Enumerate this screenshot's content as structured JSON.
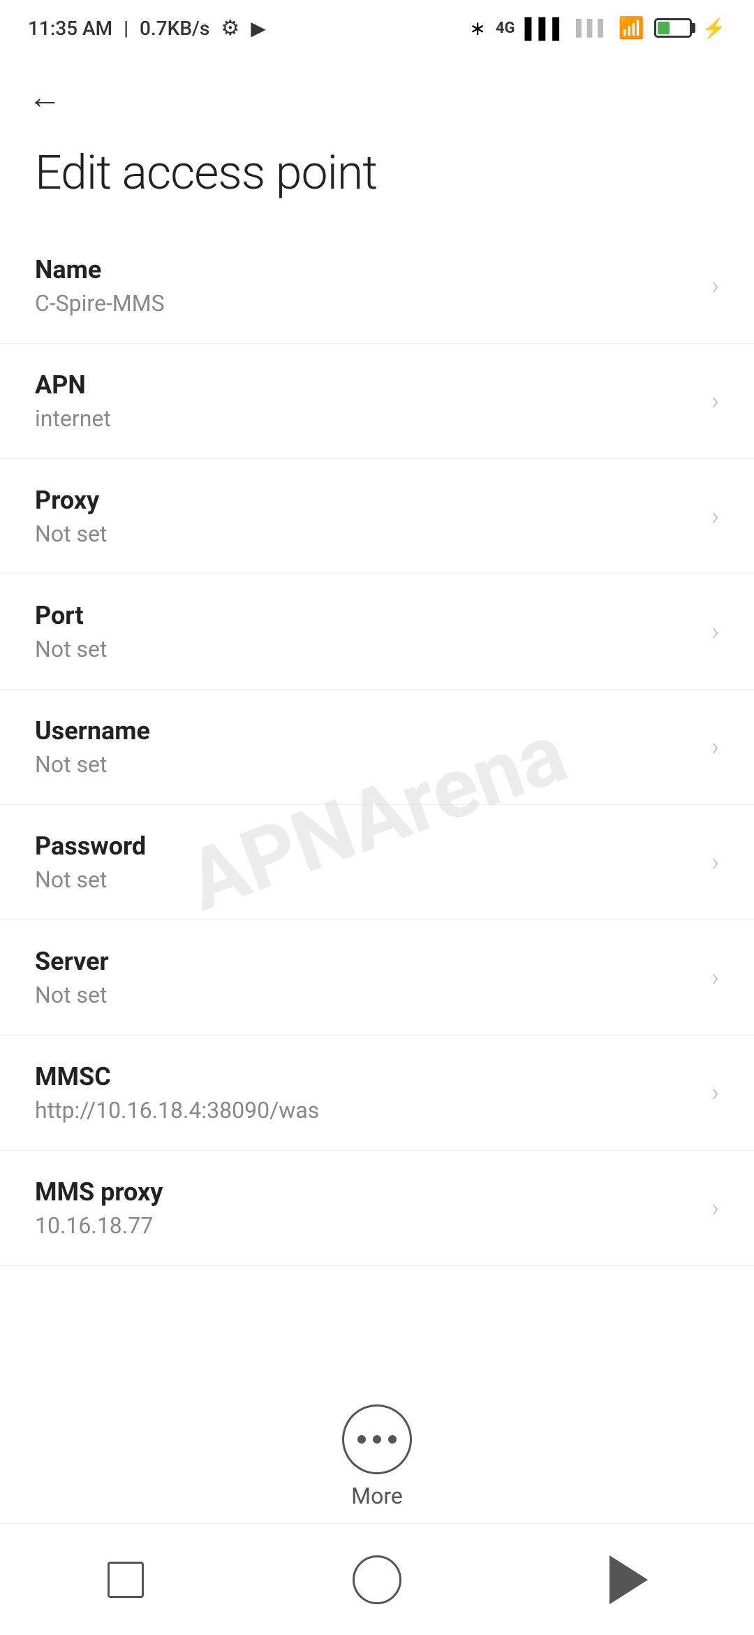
{
  "statusBar": {
    "time": "11:35 AM",
    "speed": "0.7KB/s"
  },
  "header": {
    "backLabel": "←",
    "title": "Edit access point"
  },
  "settingsItems": [
    {
      "label": "Name",
      "value": "C-Spire-MMS"
    },
    {
      "label": "APN",
      "value": "internet"
    },
    {
      "label": "Proxy",
      "value": "Not set"
    },
    {
      "label": "Port",
      "value": "Not set"
    },
    {
      "label": "Username",
      "value": "Not set"
    },
    {
      "label": "Password",
      "value": "Not set"
    },
    {
      "label": "Server",
      "value": "Not set"
    },
    {
      "label": "MMSC",
      "value": "http://10.16.18.4:38090/was"
    },
    {
      "label": "MMS proxy",
      "value": "10.16.18.77"
    }
  ],
  "moreButton": {
    "label": "More"
  },
  "watermark": "APNArena"
}
